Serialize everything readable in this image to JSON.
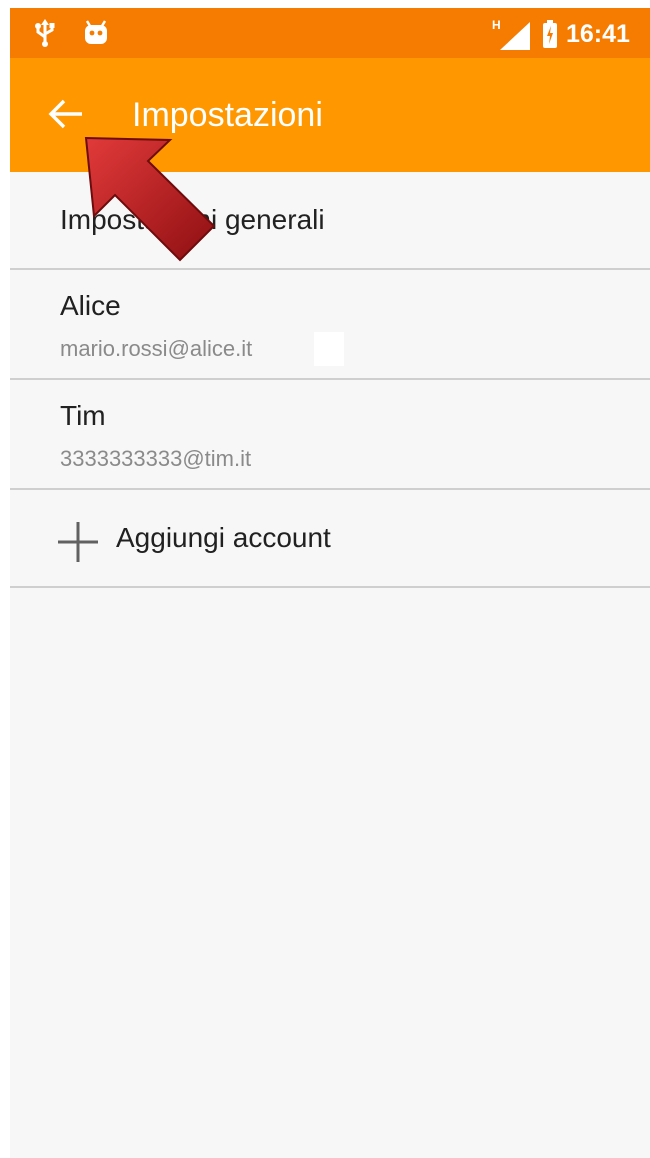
{
  "status_bar": {
    "time": "16:41",
    "network_label": "H",
    "icons": [
      "usb-icon",
      "android-icon",
      "signal-icon",
      "battery-icon"
    ]
  },
  "app_bar": {
    "title": "Impostazioni",
    "back_icon": "arrow-back-icon",
    "background": "#ff9800",
    "status_background": "#f57c00"
  },
  "list": {
    "general": {
      "label": "Impostazioni generali"
    },
    "accounts": [
      {
        "name": "Alice",
        "email": "mario.rossi@alice.it"
      },
      {
        "name": "Tim",
        "email": "3333333333@tim.it"
      }
    ],
    "add_account": {
      "label": "Aggiungi account",
      "icon": "plus-icon"
    }
  },
  "annotation": {
    "icon": "red-arrow-icon",
    "color": "#c41a1a"
  }
}
